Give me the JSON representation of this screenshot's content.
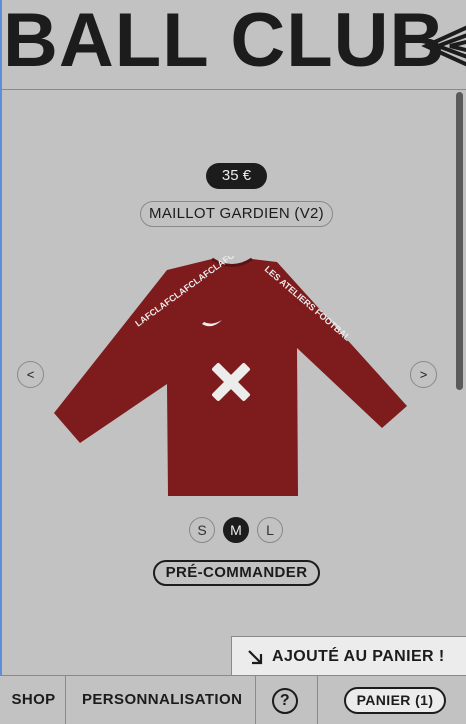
{
  "brand": {
    "title": "BALL CLUB"
  },
  "product": {
    "price": "35 €",
    "name": "MAILLOT GARDIEN (V2)",
    "sleeve_left_text": "LAFCLAFCLAFCLAFCLAFC",
    "sleeve_right_text": "LES ATELIERS FOOTBALL CLUB",
    "jersey_color": "#7e1b1d",
    "accent_color": "#ececec"
  },
  "carousel": {
    "prev_label": "<",
    "next_label": ">"
  },
  "sizes": {
    "options": [
      "S",
      "M",
      "L"
    ],
    "selected": "M"
  },
  "actions": {
    "preorder_label": "PRÉ-COMMANDER"
  },
  "toast": {
    "icon": "arrow-down-right-icon",
    "message": "AJOUTÉ AU PANIER !"
  },
  "nav": {
    "shop_label": "SHOP",
    "personalisation_label": "PERSONNALISATION",
    "help_label": "?",
    "cart_label": "PANIER (1)"
  },
  "colors": {
    "background": "#c2c2c2",
    "ink": "#1c1c1c",
    "light": "#ececec",
    "frame_accent": "#5b8fd9"
  }
}
